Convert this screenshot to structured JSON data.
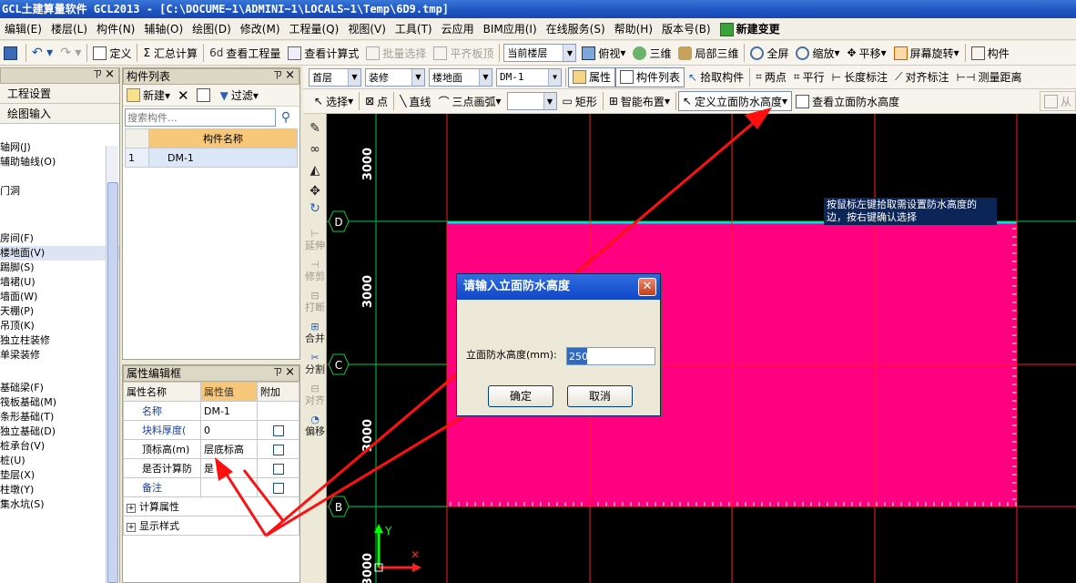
{
  "app": {
    "title": "GCL土建算量软件 GCL2013 - [C:\\DOCUME~1\\ADMINI~1\\LOCALS~1\\Temp\\6D9.tmp]"
  },
  "menu": [
    {
      "label": "编辑(E)",
      "bold": false
    },
    {
      "label": "楼层(L)",
      "bold": false
    },
    {
      "label": "构件(N)",
      "bold": false
    },
    {
      "label": "辅轴(O)",
      "bold": false
    },
    {
      "label": "绘图(D)",
      "bold": false
    },
    {
      "label": "修改(M)",
      "bold": false
    },
    {
      "label": "工程量(Q)",
      "bold": false
    },
    {
      "label": "视图(V)",
      "bold": false
    },
    {
      "label": "工具(T)",
      "bold": false
    },
    {
      "label": "云应用",
      "bold": false
    },
    {
      "label": "BIM应用(I)",
      "bold": false
    },
    {
      "label": "在线服务(S)",
      "bold": false
    },
    {
      "label": "帮助(H)",
      "bold": false
    },
    {
      "label": "版本号(B)",
      "bold": false
    },
    {
      "label": "新建变更",
      "bold": true
    }
  ],
  "toolbar1": {
    "define": "定义",
    "sum": "汇总计算",
    "view_qty": "查看工程量",
    "view_formula": "查看计算式",
    "batch_select": "批量选择",
    "flat_top": "平齐板顶",
    "floor_combo": "当前楼层",
    "top_view": "俯视",
    "three_d": "三维",
    "local_3d": "局部三维",
    "fullscreen": "全屏",
    "zoom": "缩放",
    "pan": "平移",
    "rotate": "屏幕旋转",
    "component": "构件"
  },
  "toolbar2": {
    "floor": "首层",
    "category": "装修",
    "type": "楼地面",
    "item": "DM-1",
    "properties": "属性",
    "comp_list": "构件列表",
    "pick": "拾取构件",
    "two_points": "两点",
    "parallel": "平行",
    "length_dim": "长度标注",
    "align_dim": "对齐标注",
    "measure": "测量距离"
  },
  "toolbar3": {
    "select": "选择",
    "point": "点",
    "line": "直线",
    "arc": "三点画弧",
    "rect": "矩形",
    "smart": "智能布置",
    "define_height": "定义立面防水高度",
    "view_height": "查看立面防水高度",
    "from": "从"
  },
  "left_panel": {
    "settings": "工程设置",
    "drawing": "绘图输入",
    "tree": [
      "轴网(J)",
      "辅助轴线(O)",
      "门洞",
      "房间(F)",
      "楼地面(V)",
      "踢脚(S)",
      "墙裙(U)",
      "墙面(W)",
      "天棚(P)",
      "吊顶(K)",
      "独立柱装修",
      "单梁装修",
      "基础梁(F)",
      "筏板基础(M)",
      "条形基础(T)",
      "独立基础(D)",
      "桩承台(V)",
      "桩(U)",
      "垫层(X)",
      "柱墩(Y)",
      "集水坑(S)"
    ],
    "tree_prefix": [
      "轩",
      "",
      "",
      "",
      "",
      "",
      "",
      "",
      "",
      "",
      "",
      "",
      "",
      "",
      "",
      "",
      "",
      "",
      "",
      "",
      ""
    ]
  },
  "component_list": {
    "title": "构件列表",
    "new_btn": "新建",
    "filter_btn": "过滤",
    "search_placeholder": "搜索构件...",
    "col_header": "构件名称",
    "rows": [
      {
        "index": "1",
        "name": "DM-1"
      }
    ]
  },
  "property_panel": {
    "title": "属性编辑框",
    "headers": [
      "属性名称",
      "属性值",
      "附加"
    ],
    "rows": [
      {
        "name": "名称",
        "value": "DM-1",
        "blue": true
      },
      {
        "name": "块料厚度(",
        "value": "0",
        "blue": true
      },
      {
        "name": "顶标高(m)",
        "value": "层底标高",
        "blue": false
      },
      {
        "name": "是否计算防",
        "value": "是",
        "blue": false
      },
      {
        "name": "备注",
        "value": "",
        "blue": true
      }
    ],
    "groups": [
      "计算属性",
      "显示样式"
    ]
  },
  "vtools": [
    "延伸",
    "修剪",
    "打断",
    "合并",
    "分割",
    "对齐",
    "偏移"
  ],
  "canvas": {
    "axis_labels": [
      "D",
      "C",
      "B"
    ],
    "dim_labels": [
      "3000",
      "3000",
      "3000",
      "3000"
    ],
    "tooltip": "按鼠标左键拾取需设置防水高度的边，按右键确认选择",
    "fill_color": "#ff0080",
    "edge_color": "#00e5ff",
    "grid_color": "#ff1e1e"
  },
  "dialog": {
    "title": "请输入立面防水高度",
    "label": "立面防水高度(mm):",
    "value": "250",
    "ok": "确定",
    "cancel": "取消"
  }
}
